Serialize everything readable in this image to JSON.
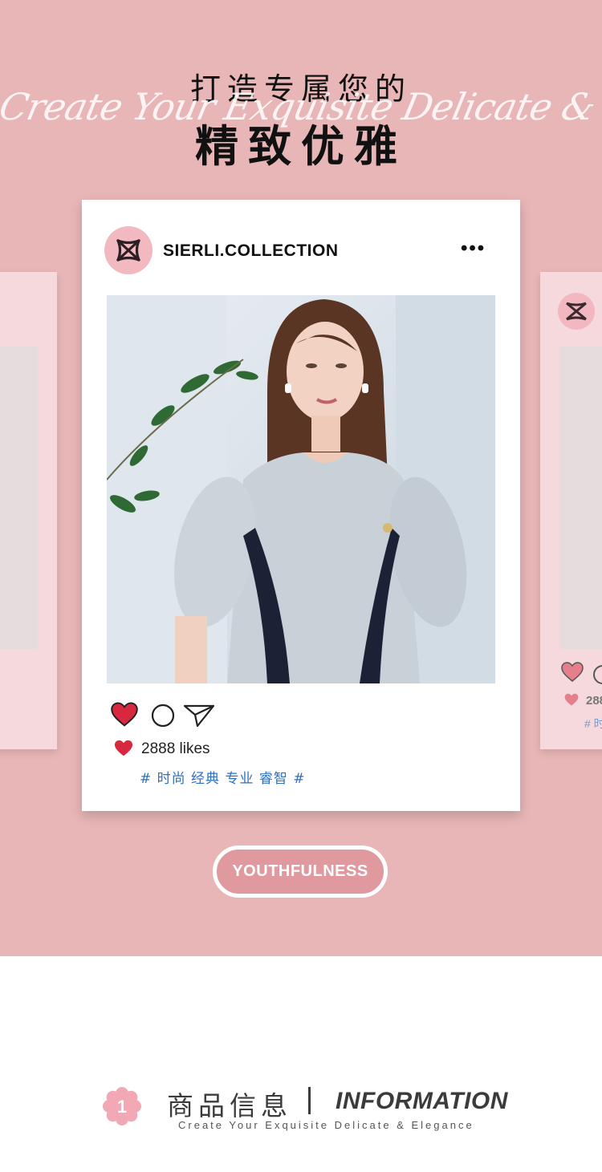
{
  "hero": {
    "title_line1": "打造专属您的",
    "title_line2": "精致优雅",
    "script_text": "Create Your Exquisite Delicate & Elegance"
  },
  "post": {
    "account_name": "SIERLI.COLLECTION",
    "more_label": "•••",
    "likes_text": "2888 likes",
    "hashtags": "# 时尚 经典 专业 睿智 #",
    "icons": [
      "heart-icon",
      "comment-icon",
      "share-icon",
      "more-icon"
    ]
  },
  "side_card_right": {
    "likes_fragment": "288",
    "tag_fragment": "# 时"
  },
  "pill_button": {
    "label": "YOUTHFULNESS"
  },
  "info_header": {
    "number": "1",
    "cn_title": "商品信息",
    "en_title": "INFORMATION",
    "subtitle": "Create Your Exquisite Delicate & Elegance"
  },
  "colors": {
    "background_pink": "#e8b6b7",
    "card_pink": "#f6d9dc",
    "heart_red": "#d8283f",
    "hashtag_blue": "#2f6fc0",
    "pill_fill": "#e0999f",
    "flower_pink": "#f0a9b5"
  }
}
